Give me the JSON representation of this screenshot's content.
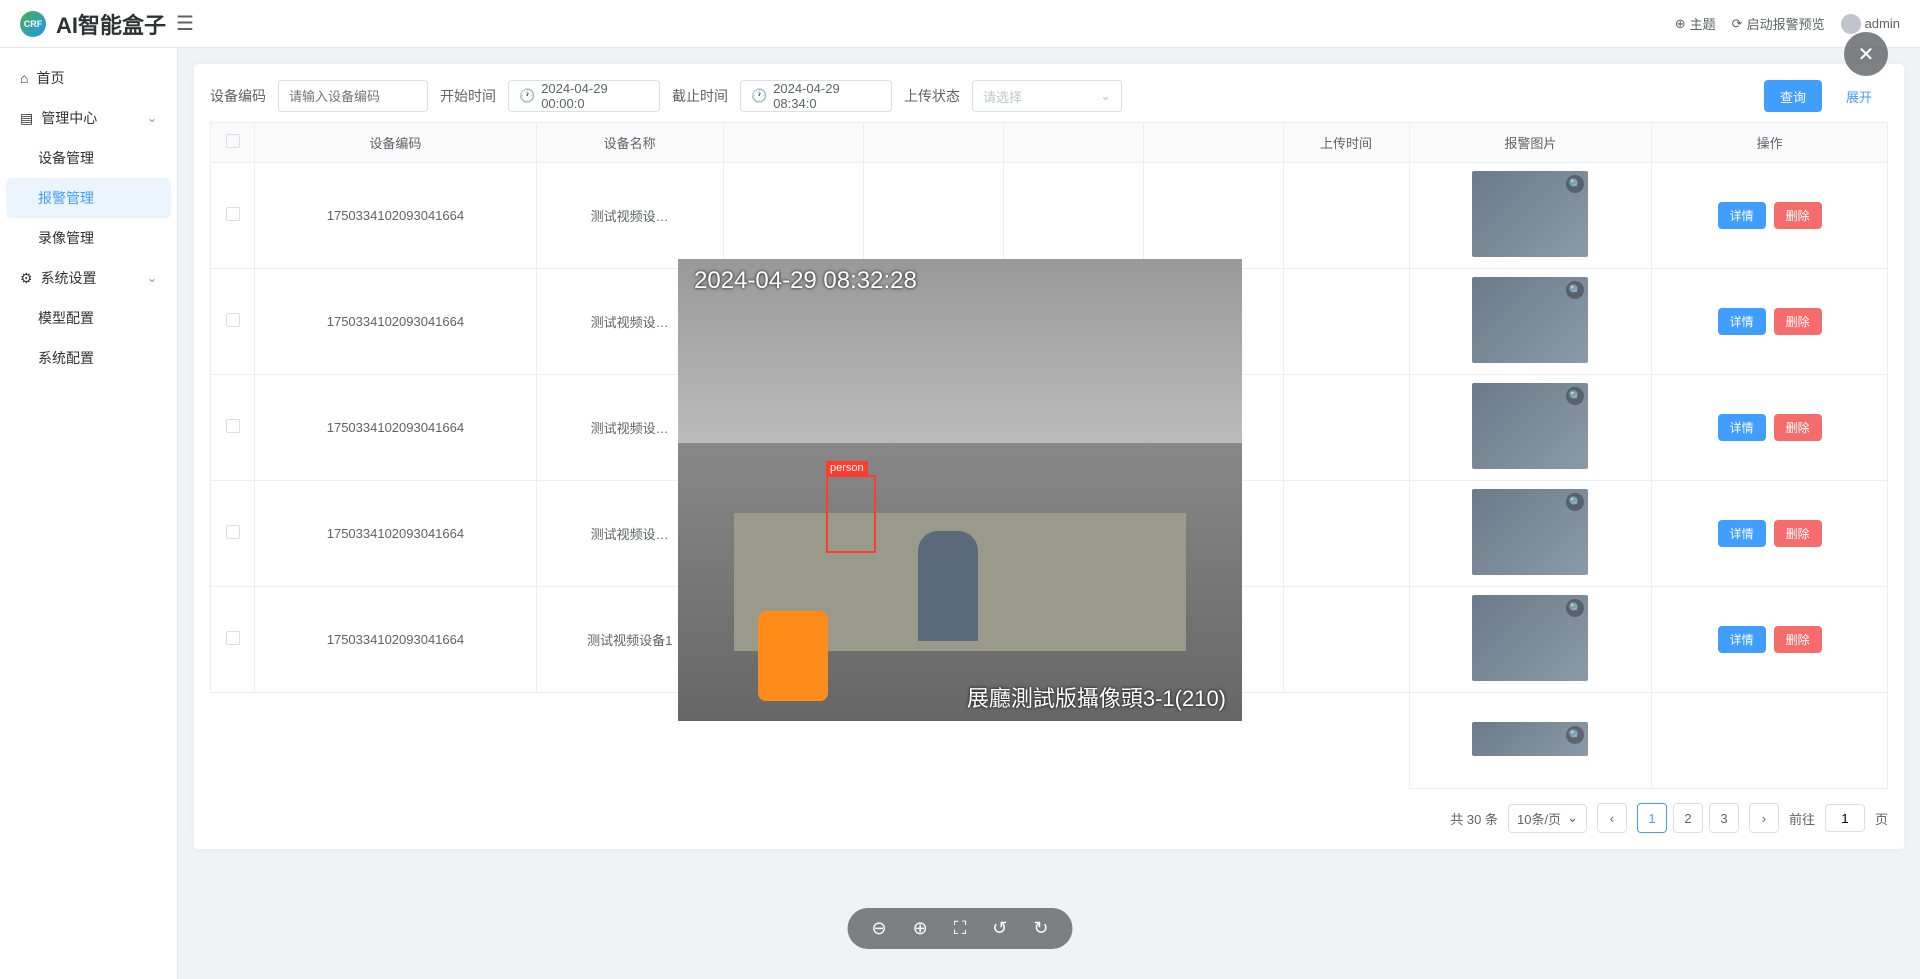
{
  "header": {
    "logo_text": "CRF",
    "app_title": "AI智能盒子",
    "theme": "主题",
    "alarm_preview": "启动报警预览",
    "user": "admin"
  },
  "sidebar": {
    "home": "首页",
    "mgmt_center": "管理中心",
    "device_mgmt": "设备管理",
    "alarm_mgmt": "报警管理",
    "record_mgmt": "录像管理",
    "sys_settings": "系统设置",
    "model_config": "模型配置",
    "sys_config": "系统配置"
  },
  "search": {
    "device_code_label": "设备编码",
    "device_code_placeholder": "请输入设备编码",
    "start_time_label": "开始时间",
    "start_time_value": "2024-04-29 00:00:0",
    "end_time_label": "截止时间",
    "end_time_value": "2024-04-29 08:34:0",
    "upload_status_label": "上传状态",
    "upload_status_placeholder": "请选择",
    "query_btn": "查询",
    "expand_btn": "展开"
  },
  "table": {
    "headers": {
      "device_code": "设备编码",
      "device_name": "设备名称",
      "upload_time": "上传时间",
      "alarm_image": "报警图片",
      "actions": "操作"
    },
    "detail_btn": "详情",
    "delete_btn": "删除",
    "rows": [
      {
        "code": "1750334102093041664",
        "name": "测试视频设…"
      },
      {
        "code": "1750334102093041664",
        "name": "测试视频设…"
      },
      {
        "code": "1750334102093041664",
        "name": "测试视频设…"
      },
      {
        "code": "1750334102093041664",
        "name": "测试视频设…"
      },
      {
        "code": "1750334102093041664",
        "name": "测试视频设备1"
      }
    ]
  },
  "pagination": {
    "total": "共 30 条",
    "page_size": "10条/页",
    "pages": [
      "1",
      "2",
      "3"
    ],
    "current": "1",
    "goto_label": "前往",
    "goto_value": "1",
    "page_suffix": "页"
  },
  "viewer": {
    "timestamp": "2024-04-29 08:32:28",
    "watermark": "展廳測試版攝像頭3-1(210)",
    "detection_label": "person"
  }
}
